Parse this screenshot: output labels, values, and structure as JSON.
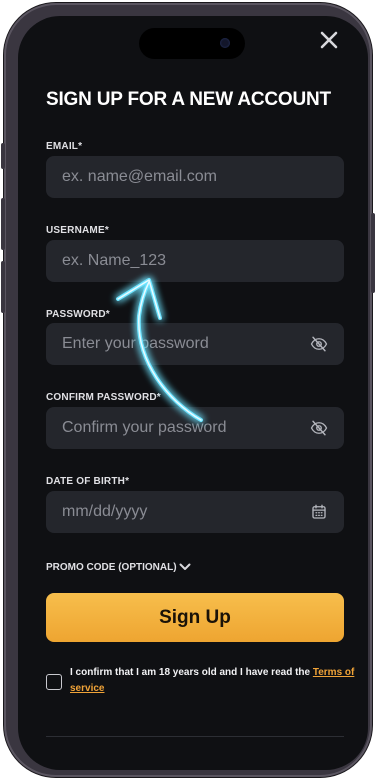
{
  "form": {
    "title": "SIGN UP FOR A NEW ACCOUNT",
    "email": {
      "label": "EMAIL*",
      "placeholder": "ex. name@email.com"
    },
    "username": {
      "label": "USERNAME*",
      "placeholder": "ex. Name_123"
    },
    "password": {
      "label": "PASSWORD*",
      "placeholder": "Enter your password"
    },
    "confirm_password": {
      "label": "CONFIRM PASSWORD*",
      "placeholder": "Confirm your password"
    },
    "dob": {
      "label": "DATE OF BIRTH*",
      "placeholder": "mm/dd/yyyy"
    },
    "promo_label": "PROMO CODE (OPTIONAL)",
    "submit_label": "Sign Up",
    "consent_text": "I confirm that I am 18 years old and I have read the",
    "terms_link": "Terms of service"
  },
  "icons": {
    "close": "close-icon",
    "eye_off": "eye-off-icon",
    "calendar": "calendar-icon",
    "chevron": "chevron-down-icon"
  },
  "colors": {
    "accent": "#f2aa3a",
    "background": "#0f1013",
    "field": "#24262c",
    "annotation_glow": "#4fd6ff"
  }
}
